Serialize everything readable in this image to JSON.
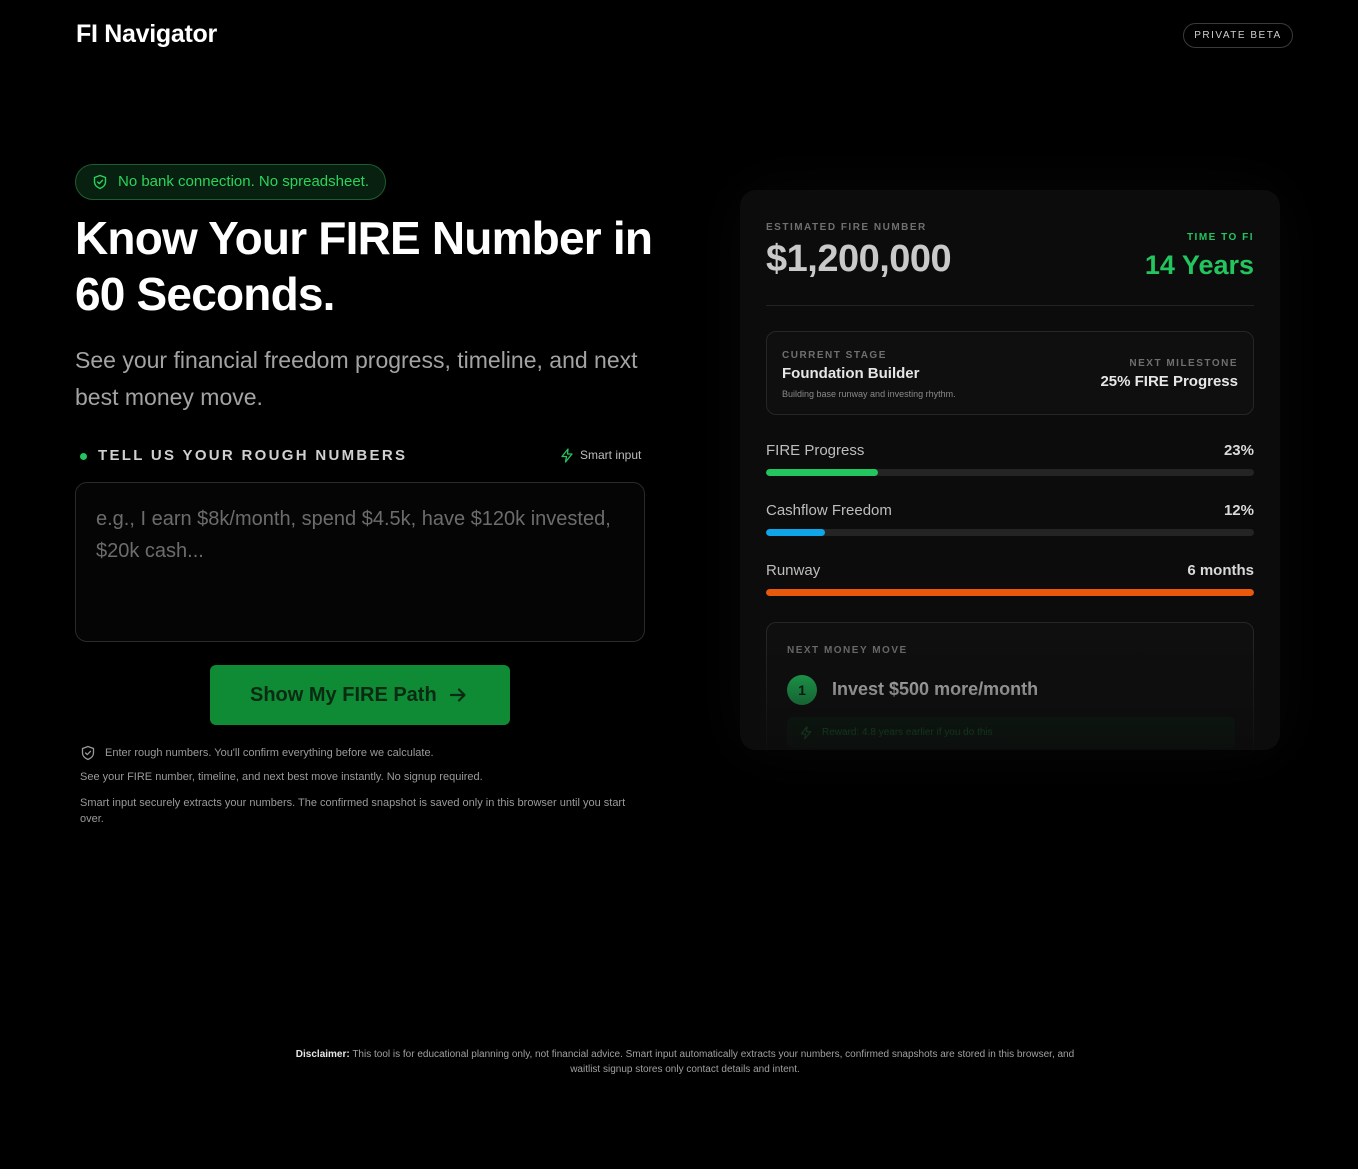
{
  "header": {
    "logo": "FI Navigator",
    "beta_label": "PRIVATE BETA"
  },
  "hero": {
    "badge": "No bank connection. No spreadsheet.",
    "title": "Know Your FIRE Number in 60 Seconds.",
    "subtitle": "See your financial freedom progress, timeline, and next best money move."
  },
  "input_section": {
    "label": "TELL US YOUR ROUGH NUMBERS",
    "smart_input": "Smart input",
    "placeholder": "e.g., I earn $8k/month, spend $4.5k, have $120k invested, $20k cash...",
    "value": "",
    "cta_label": "Show My FIRE Path",
    "note_confirm": "Enter rough numbers. You'll confirm everything before we calculate.",
    "note_instant": "See your FIRE number, timeline, and next best move instantly. No signup required.",
    "note_privacy": "Smart input securely extracts your numbers. The confirmed snapshot is saved only in this browser until you start over."
  },
  "preview": {
    "fire_label": "ESTIMATED FIRE NUMBER",
    "fire_number": "$1,200,000",
    "time_label": "TIME TO FI",
    "time_value": "14 Years",
    "stage_label": "CURRENT STAGE",
    "stage_title": "Foundation Builder",
    "stage_desc": "Building base runway and investing rhythm.",
    "milestone_label": "NEXT MILESTONE",
    "milestone_value": "25% FIRE Progress",
    "metrics": [
      {
        "name": "FIRE Progress",
        "display": "23%",
        "level": 0.23,
        "color": "#22c55e"
      },
      {
        "name": "Cashflow Freedom",
        "display": "12%",
        "level": 0.12,
        "color": "#0ea5e9"
      },
      {
        "name": "Runway",
        "display": "6 months",
        "level": 1.0,
        "color": "#ea580c"
      }
    ],
    "move_label": "NEXT MONEY MOVE",
    "move_number": "1",
    "move_title": "Invest $500 more/month",
    "move_reward": "Reward: 4.8 years earlier if you do this"
  },
  "footer": {
    "disclaimer_label": "Disclaimer:",
    "disclaimer_text": "This tool is for educational planning only, not financial advice. Smart input automatically extracts your numbers, confirmed snapshots are stored in this browser, and waitlist signup stores only contact details and intent."
  }
}
